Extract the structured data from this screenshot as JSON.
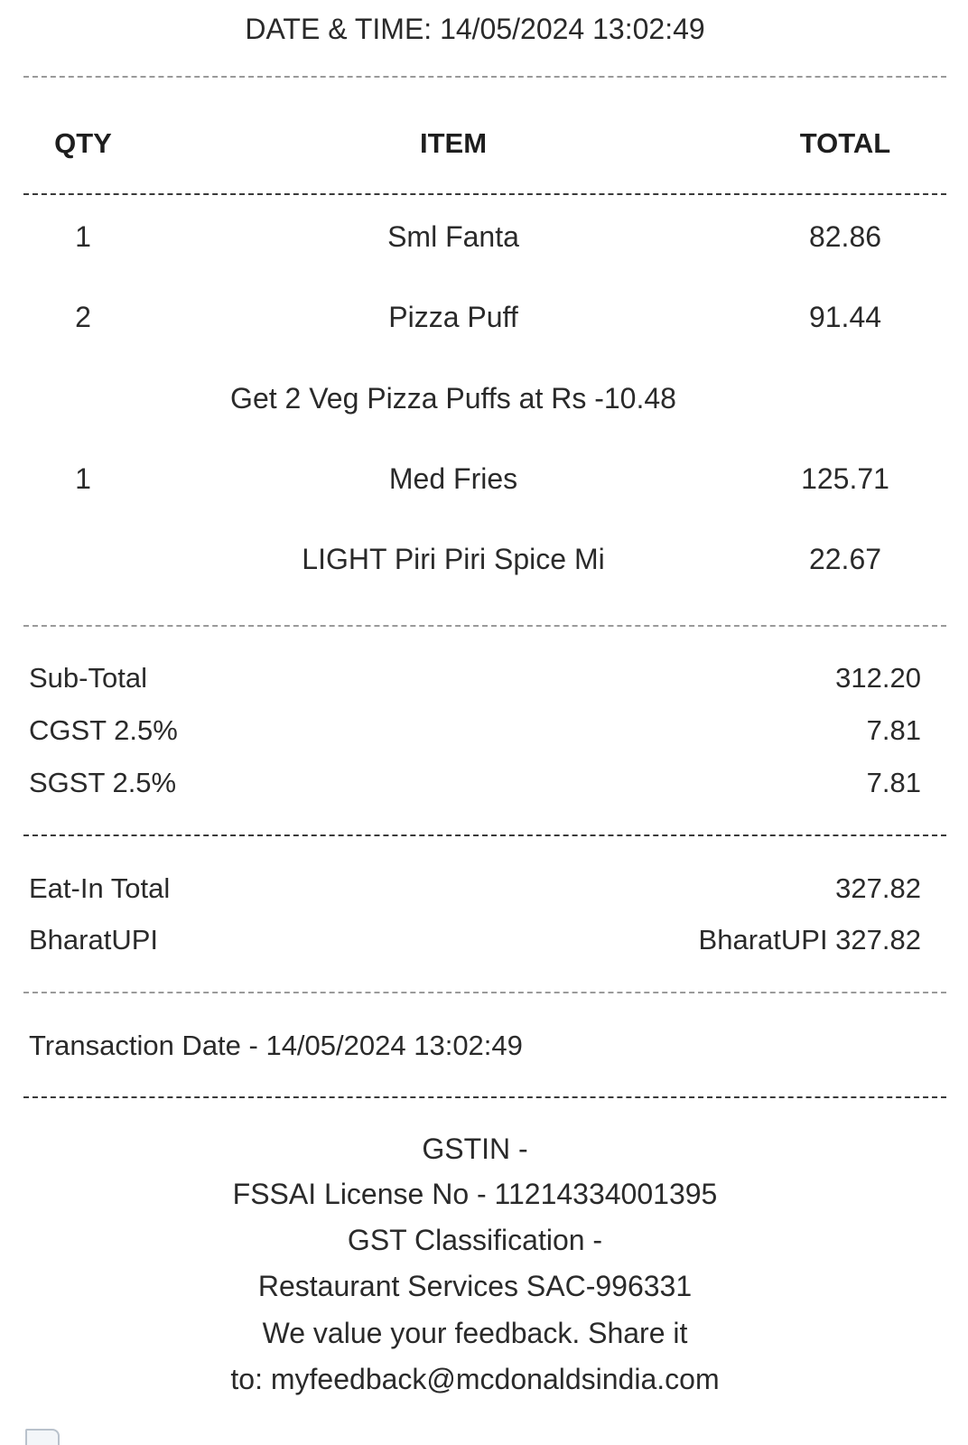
{
  "receipt": {
    "datetime_line": "DATE & TIME: 14/05/2024 13:02:49",
    "headers": {
      "qty": "QTY",
      "item": "ITEM",
      "total": "TOTAL"
    },
    "lines": [
      {
        "qty": "1",
        "item": "Sml Fanta",
        "total": "82.86"
      },
      {
        "qty": "2",
        "item": "Pizza Puff",
        "total": "91.44"
      },
      {
        "qty": "",
        "item": "Get 2 Veg Pizza Puffs at Rs -10.48",
        "total": ""
      },
      {
        "qty": "1",
        "item": "Med Fries",
        "total": "125.71"
      },
      {
        "qty": "",
        "item": "LIGHT Piri Piri Spice Mi",
        "total": "22.67"
      }
    ],
    "summary": [
      {
        "label": "Sub-Total",
        "value": "312.20"
      },
      {
        "label": "CGST 2.5%",
        "value": "7.81"
      },
      {
        "label": "SGST 2.5%",
        "value": "7.81"
      }
    ],
    "payment": [
      {
        "label": "Eat-In Total",
        "value": "327.82"
      },
      {
        "label": "BharatUPI",
        "value": "BharatUPI 327.82"
      }
    ],
    "transaction_date": "Transaction Date - 14/05/2024 13:02:49",
    "footer": [
      "GSTIN -",
      "FSSAI License No - 11214334001395",
      "GST Classification -",
      "Restaurant Services SAC-996331",
      "We value your feedback. Share it",
      "to: myfeedback@mcdonaldsindia.com"
    ]
  },
  "icons": {
    "broken_image": "broken-image-icon"
  }
}
